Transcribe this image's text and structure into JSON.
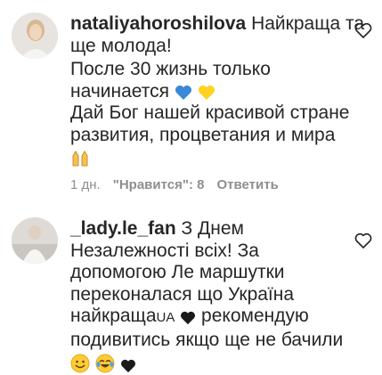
{
  "comments": [
    {
      "username": "nataliyahoroshilova",
      "first_line_text": " Найкраща та",
      "lines": [
        "ще молода!",
        "После 30 жизнь только",
        "начинается",
        "Дай Бог нашей красивой стране",
        "развития, процветания и мира"
      ],
      "emojis_line3": [
        "blue-heart",
        "yellow-heart"
      ],
      "emojis_last": [
        "raising-hands"
      ],
      "time": "1 дн.",
      "likes": "\"Нравится\": 8",
      "reply": "Ответить",
      "like_icon": "heart-outline-icon"
    },
    {
      "username": "_lady.le_fan",
      "first_line_text": " З Днем",
      "lines": [
        "Незалежності всіх! За",
        "допомогою Ле маршутки",
        "переконалася що Україна",
        "найкраща",
        "рекомендую",
        "подивитись якщо ще не бачили"
      ],
      "inline_small": "UA",
      "emojis_last": [
        "smiling-face",
        "tears-of-joy",
        "black-heart"
      ],
      "like_icon": "heart-outline-icon"
    }
  ]
}
